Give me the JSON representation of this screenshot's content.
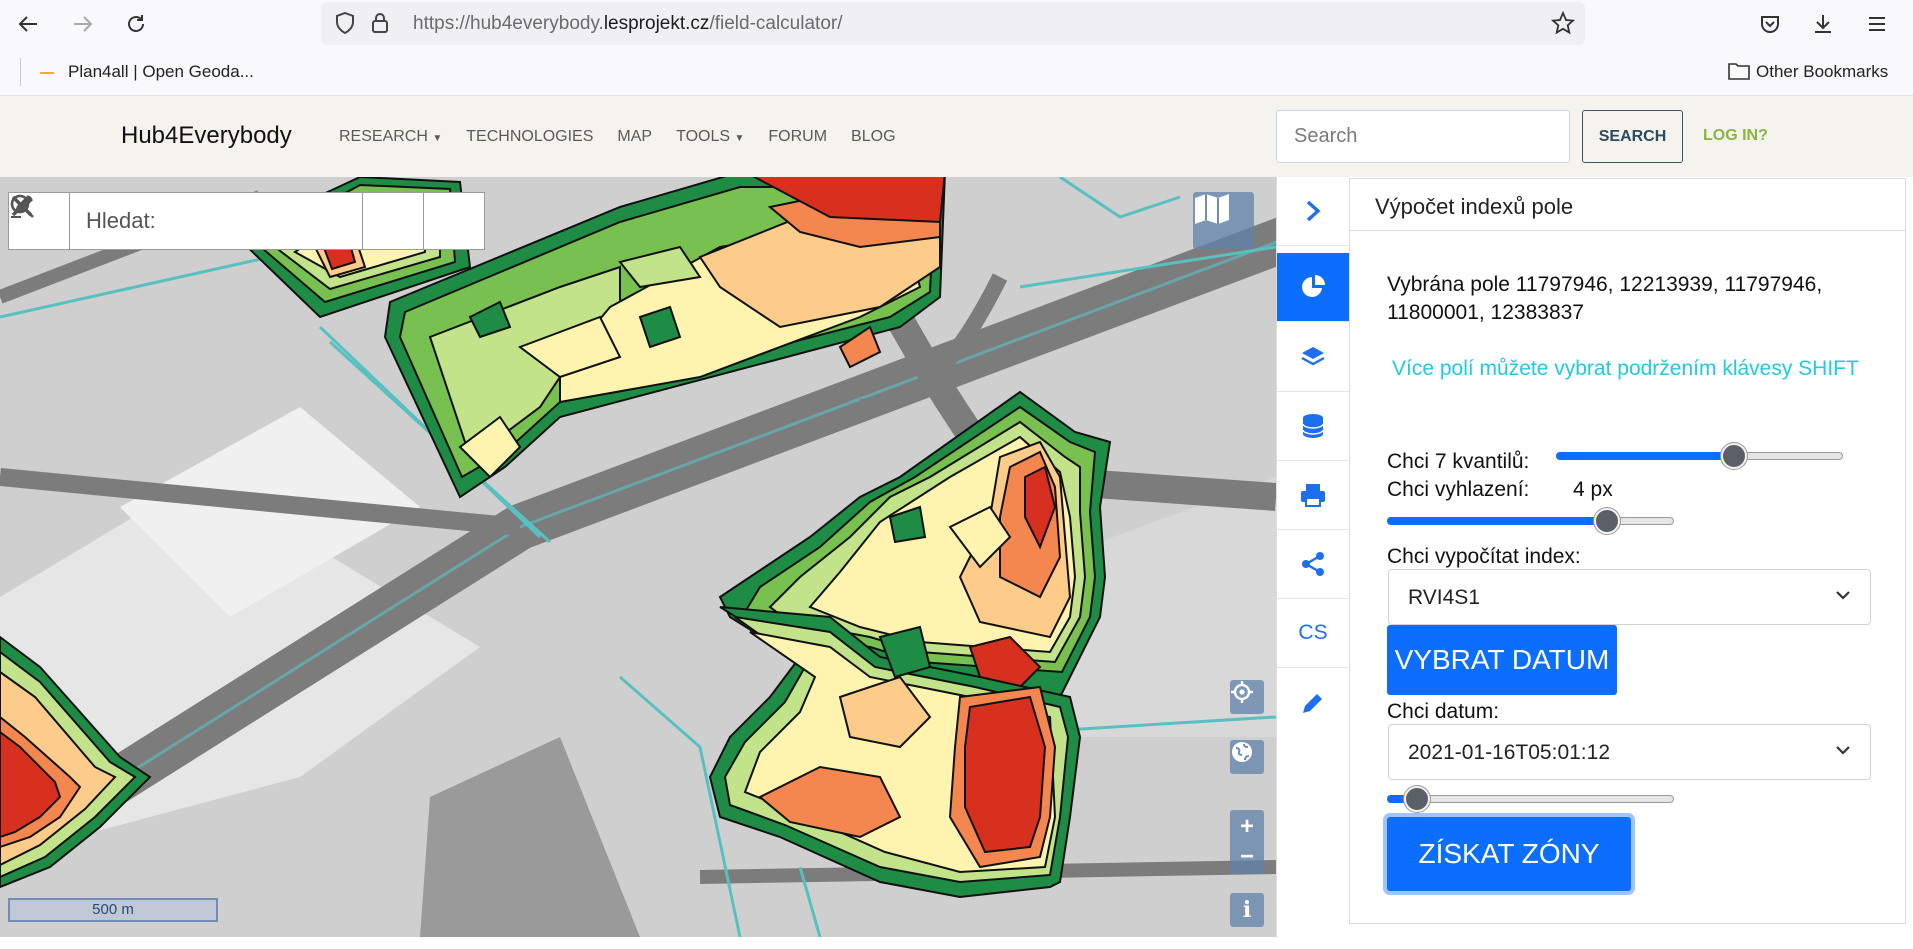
{
  "browser": {
    "url_prefix": "https://hub4everybody.",
    "url_domain": "lesprojekt.cz",
    "url_path": "/field-calculator/",
    "bookmark_1": "Plan4all | Open Geoda...",
    "bookmark_other": "Other Bookmarks"
  },
  "site": {
    "brand": "Hub4Everybody",
    "menu": [
      "RESEARCH",
      "TECHNOLOGIES",
      "MAP",
      "TOOLS",
      "FORUM",
      "BLOG"
    ],
    "search_placeholder": "Search",
    "search_button": "SEARCH",
    "login": "LOG IN?"
  },
  "map": {
    "search_placeholder": "Hledat:",
    "scale_label": "500 m",
    "zoom_in": "+",
    "zoom_out": "−",
    "info": "i"
  },
  "toolbar": {
    "lang": "CS"
  },
  "panel": {
    "title": "Výpočet indexů pole",
    "selected_fields": "Vybrána pole 11797946, 12213939, 11797946, 11800001, 12383837",
    "hint": "Více polí můžete vybrat podržením klávesy SHIFT",
    "quantiles_label": "Chci 7 kvantilů:",
    "quantiles_value": 0.62,
    "smoothing_label": "Chci vyhlazení:",
    "smoothing_value_text": "4 px",
    "smoothing_value": 0.77,
    "index_label": "Chci vypočítat index:",
    "index_selected": "RVI4S1",
    "choose_date_button": "VYBRAT DATUM",
    "date_label": "Chci datum:",
    "date_selected": "2021-01-16T05:01:12",
    "date_slider_value": 0.1,
    "get_zones_button": "ZÍSKAT ZÓNY"
  },
  "colors": {
    "primary": "#0d6efd",
    "hint": "#1ecbe1",
    "zone_red": "#d7301f",
    "zone_orange": "#f4874f",
    "zone_light_orange": "#fdcc8a",
    "zone_yellow": "#fff3b0",
    "zone_light_green": "#c2e38a",
    "zone_green": "#78c050",
    "zone_dark_green": "#1e8c45"
  }
}
